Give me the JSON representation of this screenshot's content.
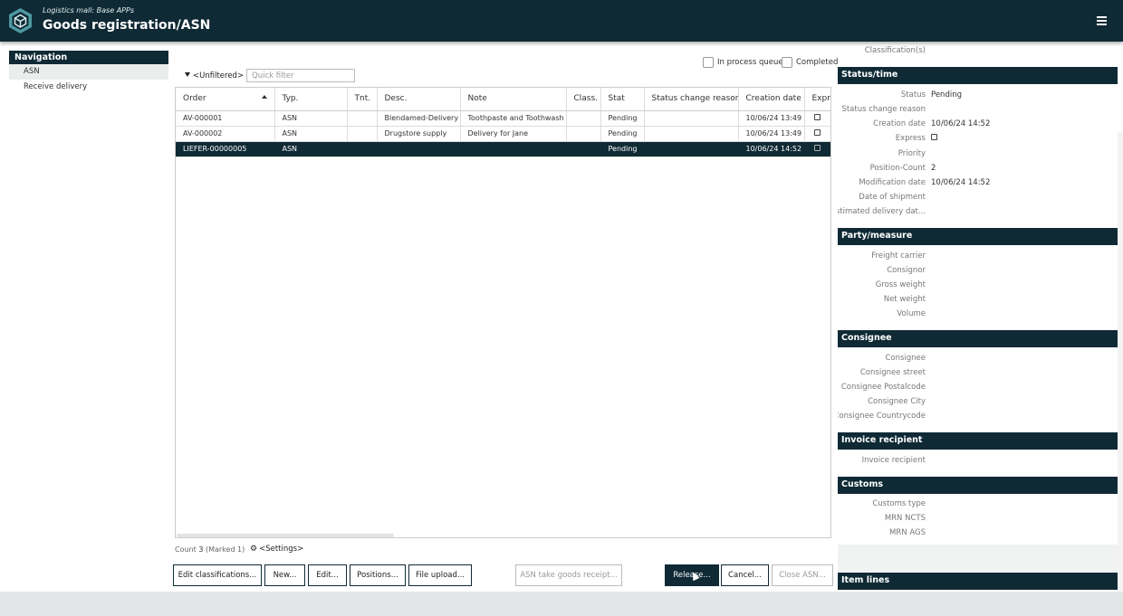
{
  "header": {
    "subtitle": "Logistics mall: Base APPs",
    "title": "Goods registration/ASN",
    "menu_icon": "hamburger-icon",
    "logo_icon": "hexagon-logo-icon",
    "colors": {
      "primary": "#0f2a35",
      "accent": "#5aa9b0"
    }
  },
  "navigation": {
    "title": "Navigation",
    "items": [
      {
        "label": "ASN"
      },
      {
        "label": "Receive delivery"
      }
    ]
  },
  "filter": {
    "label": "<Unfiltered>",
    "quick_placeholder": "Quick filter",
    "in_process_label": "In process queue",
    "completed_label": "Completed"
  },
  "grid": {
    "columns": [
      "Order",
      "Typ.",
      "Tnt.",
      "Desc.",
      "Note",
      "Class.",
      "Stat",
      "Status change reason",
      "Creation date",
      "Expr."
    ],
    "rows": [
      {
        "order": "AV-000001",
        "typ": "ASN",
        "tnt": "",
        "desc": "Blendamed-Delivery",
        "note": "Toothpaste and Toothwash",
        "class": "",
        "stat": "Pending",
        "reason": "",
        "created": "10/06/24 13:49"
      },
      {
        "order": "AV-000002",
        "typ": "ASN",
        "tnt": "",
        "desc": "Drugstore supply",
        "note": "Delivery for Jane",
        "class": "",
        "stat": "Pending",
        "reason": "",
        "created": "10/06/24 13:49"
      },
      {
        "order": "LIEFER-00000005",
        "typ": "ASN",
        "tnt": "",
        "desc": "",
        "note": "",
        "class": "",
        "stat": "Pending",
        "reason": "",
        "created": "10/06/24 14:52"
      }
    ]
  },
  "footer": {
    "count_label": "Count",
    "count_value": "3",
    "marked_text": "(Marked 1)",
    "settings_label": "<Settings>"
  },
  "buttons": {
    "edit_classifications": "Edit classifications...",
    "new": "New...",
    "edit": "Edit...",
    "positions": "Positions...",
    "file_upload": "File upload...",
    "asn_take_goods_receipt": "ASN take goods receipt...",
    "release": "Release...",
    "cancel": "Cancel...",
    "close_asn": "Close ASN..."
  },
  "detail": {
    "classifications_label": "Classification(s)",
    "status_time": {
      "title": "Status/time",
      "status_label": "Status",
      "status_value": "Pending",
      "status_change_reason_label": "Status change reason",
      "creation_date_label": "Creation date",
      "creation_date_value": "10/06/24 14:52",
      "express_label": "Express",
      "priority_label": "Priority",
      "position_count_label": "Position-Count",
      "position_count_value": "2",
      "modification_date_label": "Modification date",
      "modification_date_value": "10/06/24 14:52",
      "date_of_shipment_label": "Date of shipment",
      "estimated_delivery_label": "Estimated delivery dat..."
    },
    "party_measure": {
      "title": "Party/measure",
      "freight_carrier_label": "Freight carrier",
      "consignor_label": "Consignor",
      "gross_weight_label": "Gross weight",
      "net_weight_label": "Net weight",
      "volume_label": "Volume"
    },
    "consignee": {
      "title": "Consignee",
      "consignee_label": "Consignee",
      "street_label": "Consignee street",
      "postalcode_label": "Consignee Postalcode",
      "city_label": "Consignee City",
      "countrycode_label": "Consignee Countrycode"
    },
    "invoice": {
      "title": "Invoice recipient",
      "recipient_label": "Invoice recipient"
    },
    "customs": {
      "title": "Customs",
      "type_label": "Customs type",
      "mrn_ncts_label": "MRN NCTS",
      "mrn_ags_label": "MRN AGS"
    },
    "item_lines": {
      "title": "Item lines"
    }
  }
}
